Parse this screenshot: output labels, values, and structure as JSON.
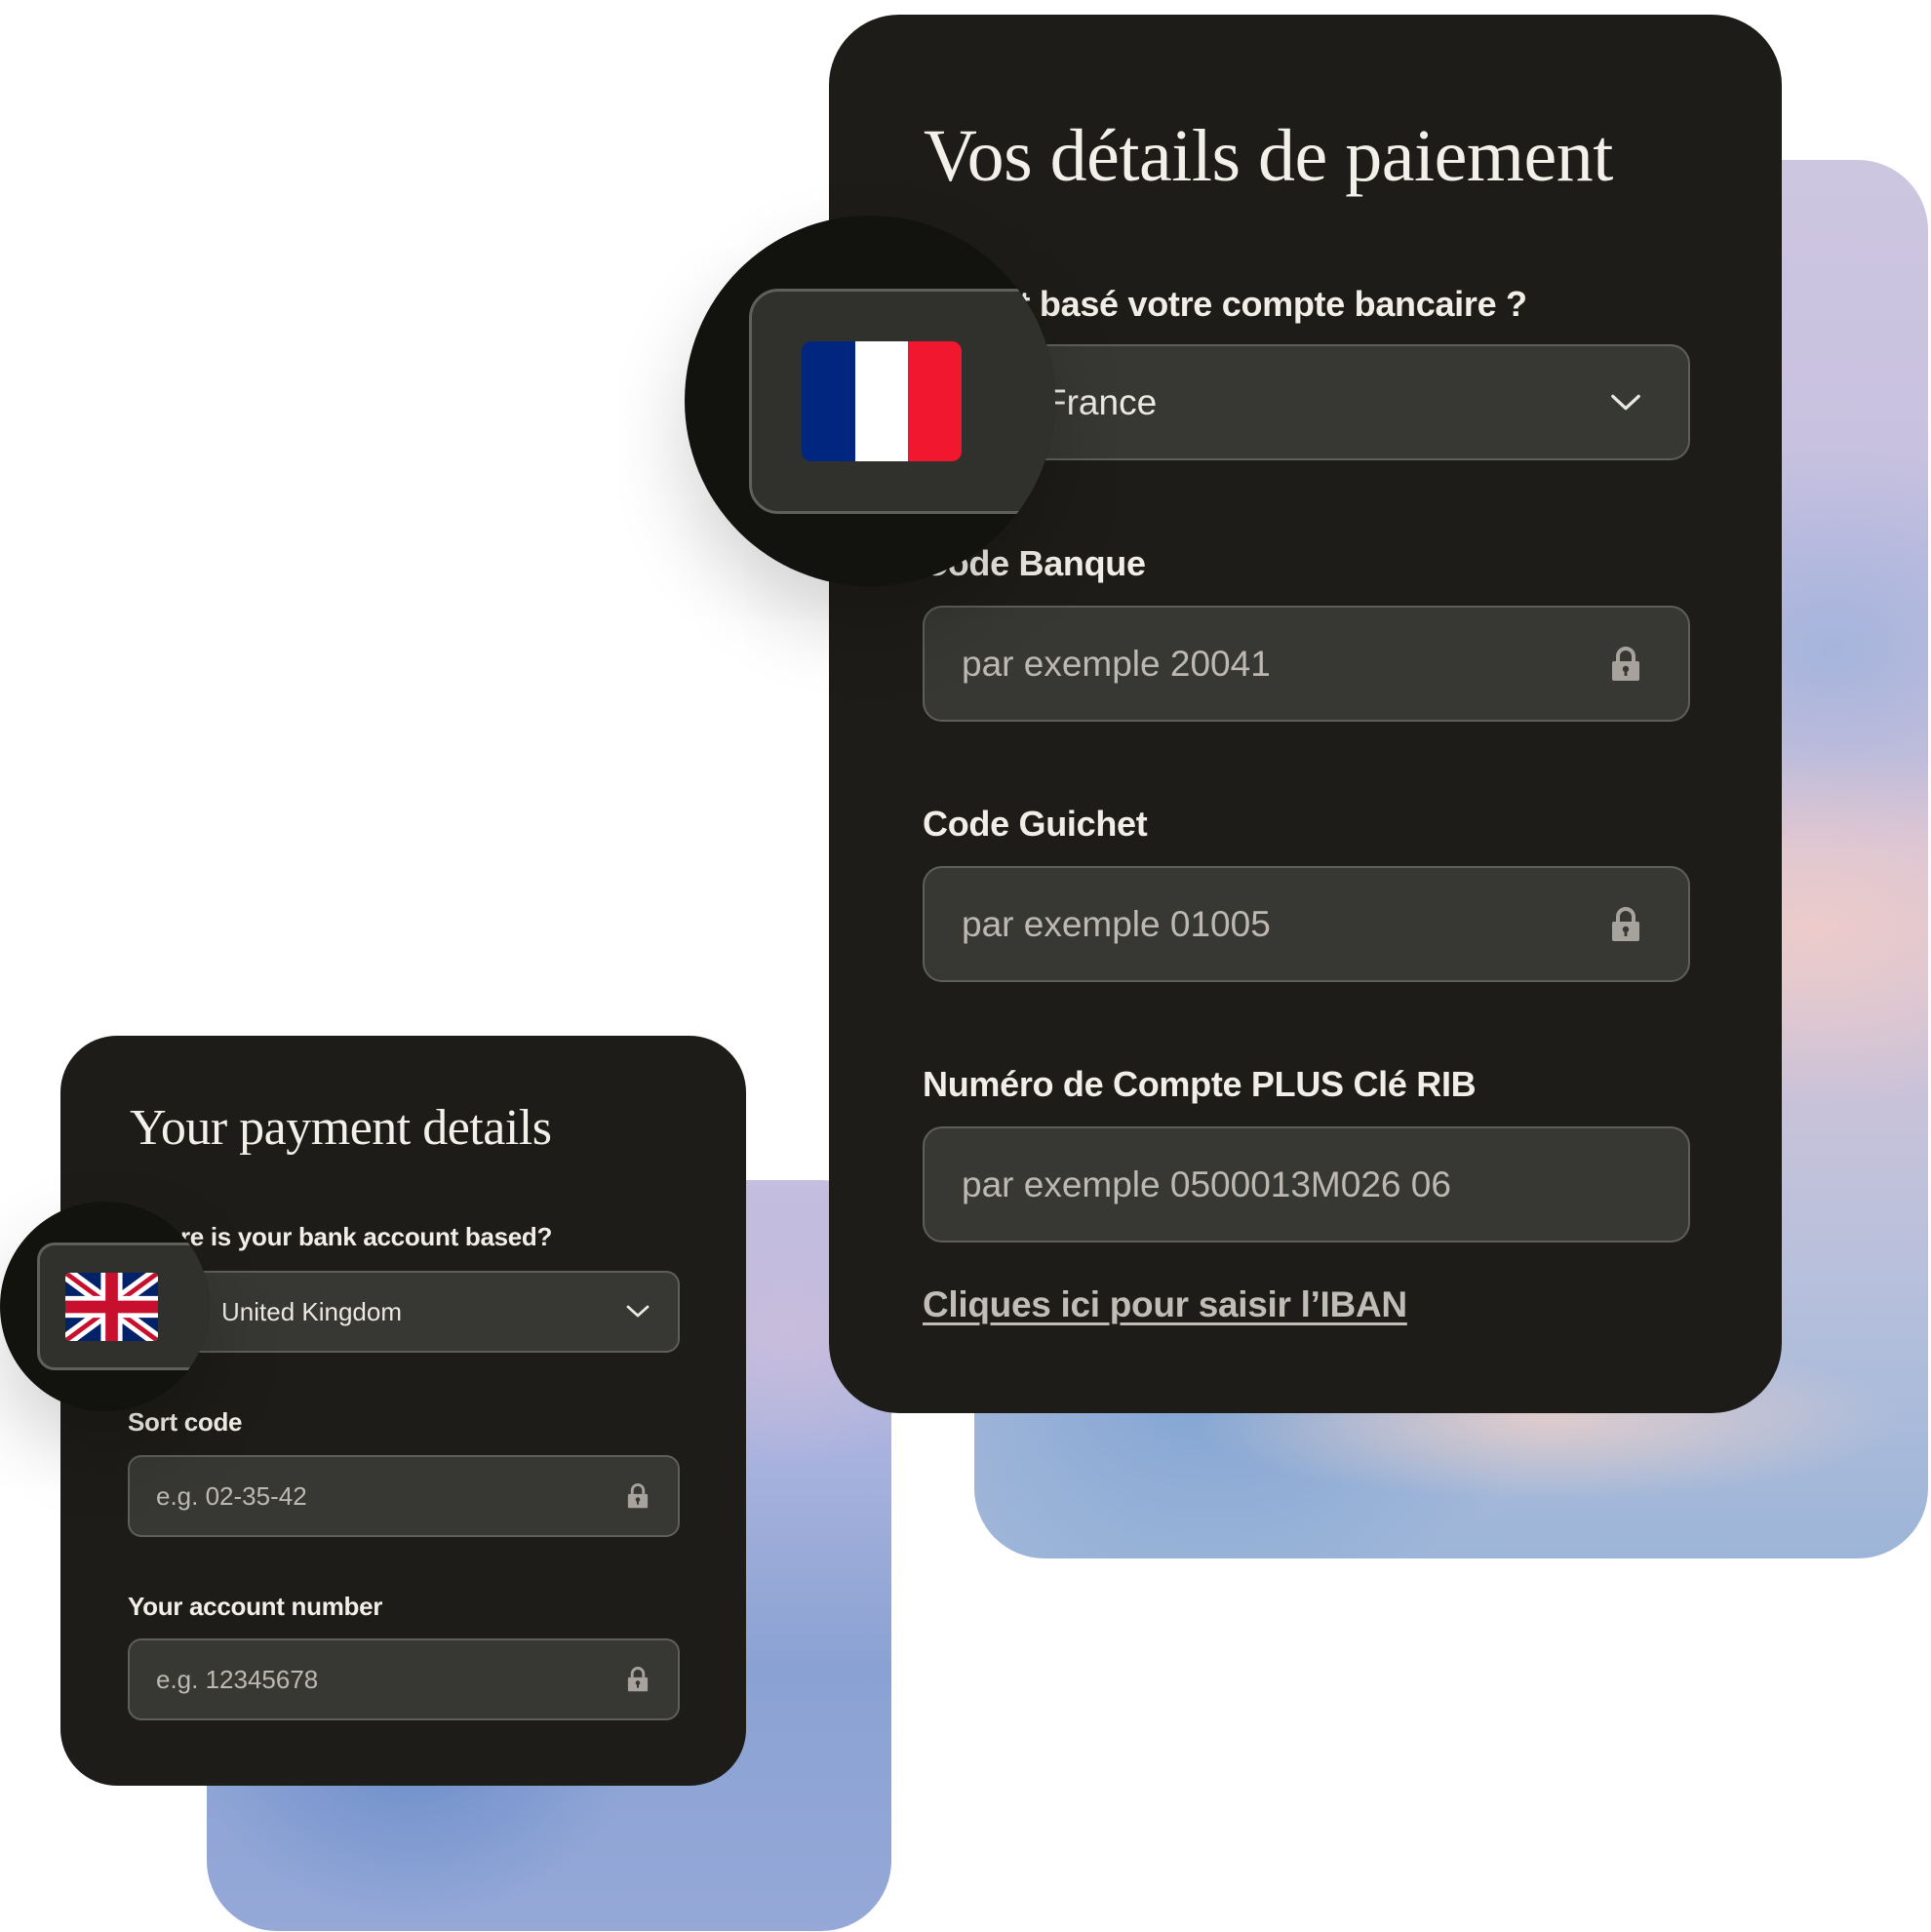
{
  "french_form": {
    "title": "Vos détails de paiement",
    "country_label": "Où est basé votre compte bancaire ?",
    "country_select": {
      "value": "France",
      "flag": "france-flag",
      "icon": "chevron-down-icon"
    },
    "fields": [
      {
        "label": "Code Banque",
        "placeholder": "par exemple 20041",
        "icon": "lock-icon"
      },
      {
        "label": "Code Guichet",
        "placeholder": "par exemple 01005",
        "icon": "lock-icon"
      },
      {
        "label": "Numéro de Compte PLUS Clé RIB",
        "placeholder": "par exemple 0500013M026 06",
        "icon": null
      }
    ],
    "iban_link": "Cliques ici pour saisir l’IBAN"
  },
  "english_form": {
    "title": "Your payment details",
    "country_label": "Where is your bank account based?",
    "country_select": {
      "value": "United Kingdom",
      "flag": "uk-flag",
      "icon": "chevron-down-icon"
    },
    "fields": [
      {
        "label": "Sort code",
        "placeholder": "e.g. 02-35-42",
        "icon": "lock-icon"
      },
      {
        "label": "Your account number",
        "placeholder": "e.g. 12345678",
        "icon": "lock-icon"
      }
    ]
  },
  "colors": {
    "card_bg": "#1d1c18",
    "field_bg": "#373734",
    "field_border": "#5e5e5a",
    "text": "#f1eee8",
    "placeholder": "#bdb9b2",
    "icon": "#a7a39c",
    "flag_fr": [
      "#002680",
      "#ffffff",
      "#f0172f"
    ],
    "flag_uk_blue": "#012169",
    "flag_uk_red": "#c8102e"
  }
}
